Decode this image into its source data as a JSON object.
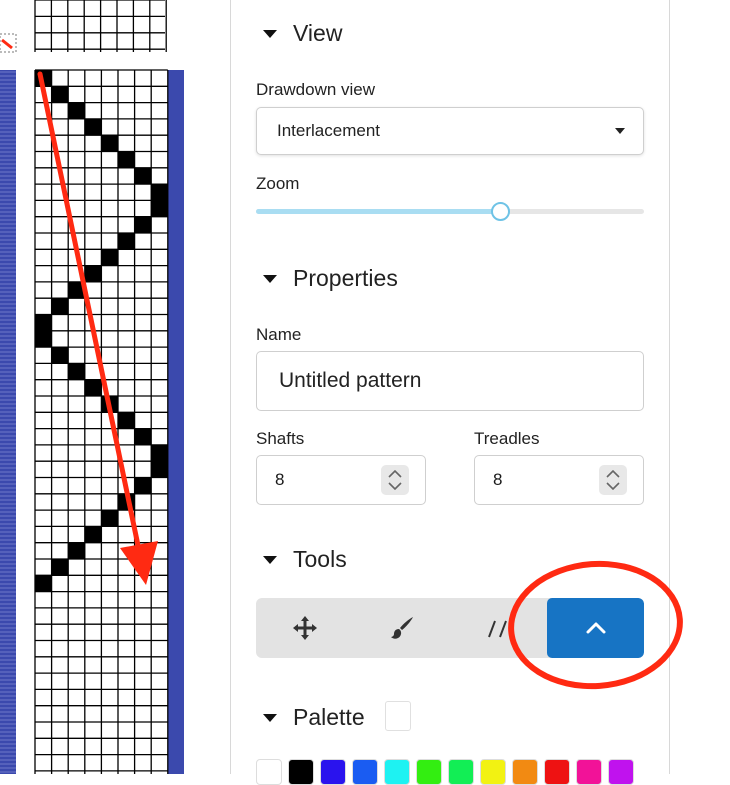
{
  "view": {
    "title": "View",
    "drawdown_label": "Drawdown view",
    "drawdown_value": "Interlacement",
    "zoom_label": "Zoom",
    "zoom_level": 0.63
  },
  "properties": {
    "title": "Properties",
    "name_label": "Name",
    "name_value": "Untitled pattern",
    "shafts_label": "Shafts",
    "shafts_value": "8",
    "treadles_label": "Treadles",
    "treadles_value": "8"
  },
  "tools": {
    "title": "Tools",
    "items": [
      "move-icon",
      "paint-brush-icon",
      "line-draw-icon",
      "chevron-up-icon"
    ],
    "active": "chevron-up-icon"
  },
  "palette": {
    "title": "Palette",
    "colors": [
      "#ffffff",
      "#000000",
      "#2a13ee",
      "#1a5cf2",
      "#1ef2f2",
      "#33ee11",
      "#12ee55",
      "#f2f212",
      "#f28a12",
      "#ee1212",
      "#f21298",
      "#c012ee"
    ]
  },
  "colors": {
    "accent": "#1774c4",
    "annotation": "#ff2a12",
    "weft": "#3b49ad"
  },
  "drawdown": {
    "threads": 8,
    "diagonal_cells": [
      0,
      1,
      2,
      3,
      4,
      5,
      6,
      7,
      7,
      6,
      5,
      4,
      3,
      2,
      1,
      0,
      0,
      1,
      2,
      3,
      4,
      5,
      6,
      7,
      7,
      6,
      5,
      4,
      3,
      2,
      1,
      0
    ]
  }
}
